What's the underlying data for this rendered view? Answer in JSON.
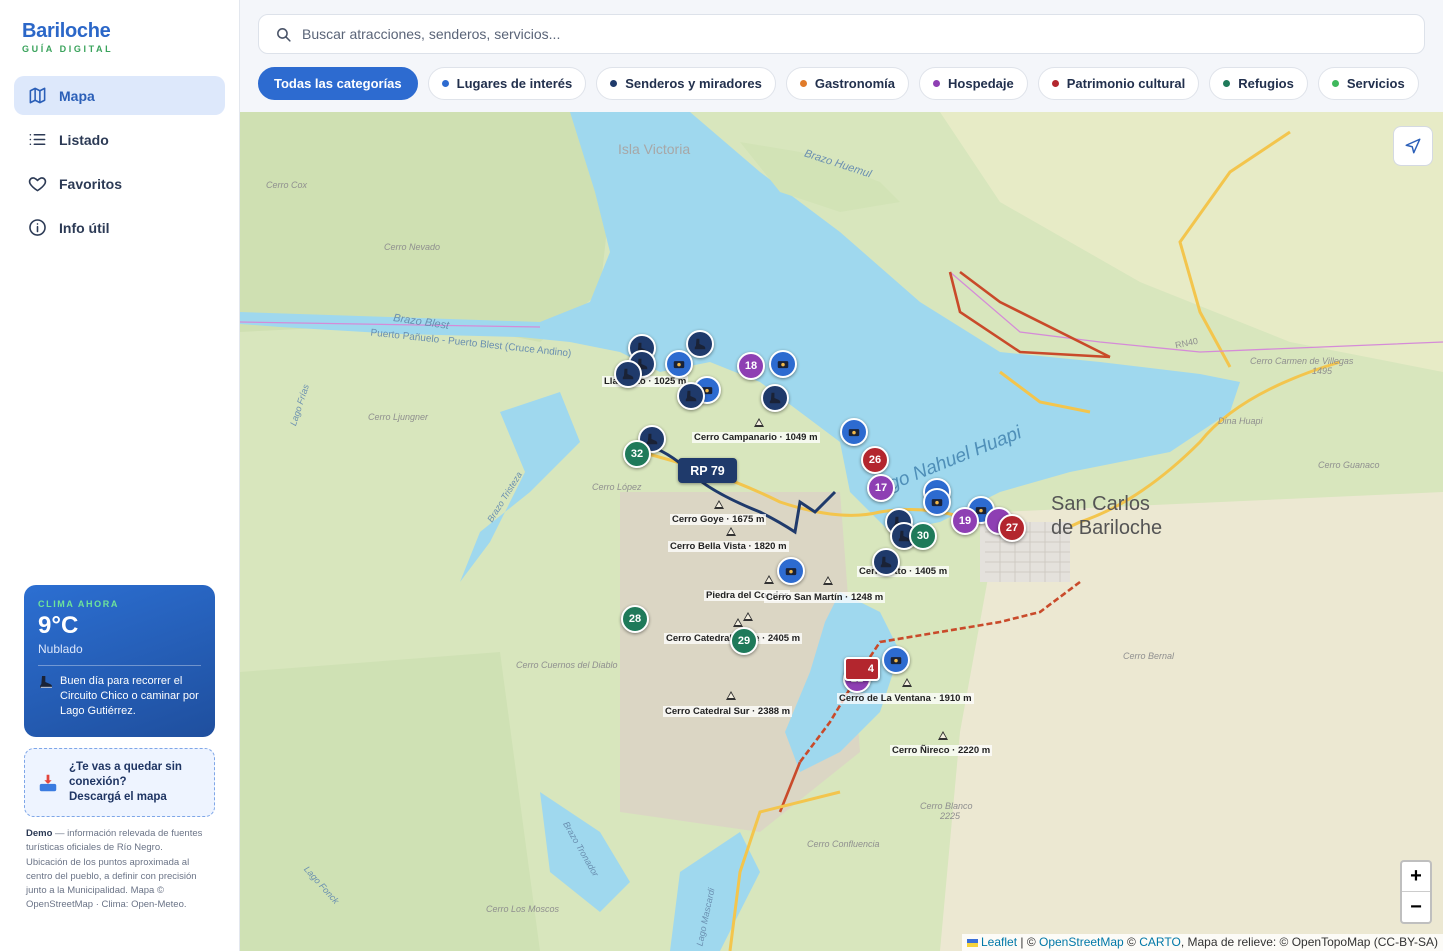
{
  "brand": {
    "name": "Bariloche",
    "subtitle": "GUÍA DIGITAL"
  },
  "nav": [
    {
      "label": "Mapa",
      "icon": "map-icon",
      "active": true
    },
    {
      "label": "Listado",
      "icon": "list-icon",
      "active": false
    },
    {
      "label": "Favoritos",
      "icon": "heart-icon",
      "active": false
    },
    {
      "label": "Info útil",
      "icon": "info-icon",
      "active": false
    }
  ],
  "weather": {
    "label": "CLIMA AHORA",
    "temp": "9°C",
    "condition": "Nublado",
    "tip": "Buen día para recorrer el Circuito Chico o caminar por Lago Gutiérrez."
  },
  "offline": {
    "line1": "¿Te vas a quedar sin conexión?",
    "line2": "Descargá el mapa"
  },
  "disclaimer": {
    "bold": "Demo",
    "text": " — información relevada de fuentes turísticas oficiales de Río Negro. Ubicación de los puntos aproximada al centro del pueblo, a definir con precisión junto a la Municipalidad. Mapa © OpenStreetMap · Clima: Open-Meteo."
  },
  "search": {
    "placeholder": "Buscar atracciones, senderos, servicios..."
  },
  "categories": [
    {
      "label": "Todas las categorías",
      "active": true,
      "color": ""
    },
    {
      "label": "Lugares de interés",
      "active": false,
      "color": "#2d6bd0"
    },
    {
      "label": "Senderos y miradores",
      "active": false,
      "color": "#1f3a6b"
    },
    {
      "label": "Gastronomía",
      "active": false,
      "color": "#e07b2a"
    },
    {
      "label": "Hospedaje",
      "active": false,
      "color": "#8e3fb3"
    },
    {
      "label": "Patrimonio cultural",
      "active": false,
      "color": "#b3262e"
    },
    {
      "label": "Refugios",
      "active": false,
      "color": "#1f7a5a"
    },
    {
      "label": "Servicios",
      "active": false,
      "color": "#3fb85c"
    }
  ],
  "map": {
    "route_label": "RP 79",
    "peaks": [
      {
        "label": "Llao Llao · 1025 m"
      },
      {
        "label": "Cerro Campanario · 1049 m"
      },
      {
        "label": "Cerro Goye · 1675 m"
      },
      {
        "label": "Cerro Bella Vista · 1820 m"
      },
      {
        "label": "Piedra del Condor"
      },
      {
        "label": "Cerro San Martín · 1248 m"
      },
      {
        "label": "Cerro Otto · 1405 m"
      },
      {
        "label": "Cerro Catedral Norte · 2405 m"
      },
      {
        "label": "Cerro Catedral Sur · 2388 m"
      },
      {
        "label": "Cerro de La Ventana · 1910 m"
      },
      {
        "label": "Cerro Ñireco · 2220 m"
      }
    ],
    "place_labels": [
      "Isla Victoria",
      "Brazo Huemul",
      "Cerro Cox",
      "Cerro Nevado",
      "Brazo Blest",
      "Puerto Pañuelo - Puerto Blest (Cruce Andino)",
      "Cerro Ljungner",
      "Lago Frías",
      "Brazo Tristeza",
      "Cerro López",
      "Cerro Cuernos del Diablo",
      "Lago Nahuel Huapi",
      "RN40",
      "Cerro Carmen de Villegas",
      "1495",
      "Dina Huapi",
      "Cerro Guanaco",
      "Cerro Bernal",
      "Cerro Blanco",
      "2225",
      "Cerro Confluencia",
      "Brazo Tronador",
      "Lago Fonck",
      "Cerro Los Moscos",
      "Lago Mascardi"
    ],
    "city": {
      "line1": "San Carlos",
      "line2": "de Bariloche"
    },
    "markers": [
      {
        "type": "senderos",
        "number": ""
      },
      {
        "type": "senderos",
        "number": ""
      },
      {
        "type": "senderos",
        "number": ""
      },
      {
        "type": "senderos",
        "number": ""
      },
      {
        "type": "lugares",
        "number": ""
      },
      {
        "type": "lugares",
        "number": ""
      },
      {
        "type": "hospedaje",
        "number": "18"
      },
      {
        "type": "lugares",
        "number": ""
      },
      {
        "type": "senderos",
        "number": ""
      },
      {
        "type": "lugares",
        "number": ""
      },
      {
        "type": "senderos",
        "number": ""
      },
      {
        "type": "senderos",
        "number": ""
      },
      {
        "type": "refugios",
        "number": "32"
      },
      {
        "type": "lugares",
        "number": ""
      },
      {
        "type": "patrimonio",
        "number": "26"
      },
      {
        "type": "hospedaje",
        "number": "17"
      },
      {
        "type": "lugares",
        "number": ""
      },
      {
        "type": "senderos",
        "number": ""
      },
      {
        "type": "senderos",
        "number": ""
      },
      {
        "type": "refugios",
        "number": "30"
      },
      {
        "type": "lugares",
        "number": ""
      },
      {
        "type": "hospedaje",
        "number": "19"
      },
      {
        "type": "hospedaje",
        "number": ""
      },
      {
        "type": "patrimonio",
        "number": "27"
      },
      {
        "type": "senderos",
        "number": ""
      },
      {
        "type": "lugares",
        "number": ""
      },
      {
        "type": "refugios",
        "number": "28"
      },
      {
        "type": "refugios",
        "number": "29"
      },
      {
        "type": "lugares",
        "number": ""
      },
      {
        "type": "hospedaje",
        "number": "21"
      },
      {
        "type": "patrimonio",
        "number": "4"
      }
    ],
    "zoom_in": "+",
    "zoom_out": "−",
    "attribution": {
      "leaflet": "Leaflet",
      "sep1": " | © ",
      "osm": "OpenStreetMap",
      "sep2": " © ",
      "carto": "CARTO",
      "rest": ", Mapa de relieve: © OpenTopoMap (CC-BY-SA)"
    }
  },
  "colors": {
    "lugares": "#2d6bd0",
    "senderos": "#1f3a6b",
    "hospedaje": "#8e3fb3",
    "patrimonio": "#b3262e",
    "refugios": "#1f7a5a",
    "water": "#9fd8ee"
  }
}
